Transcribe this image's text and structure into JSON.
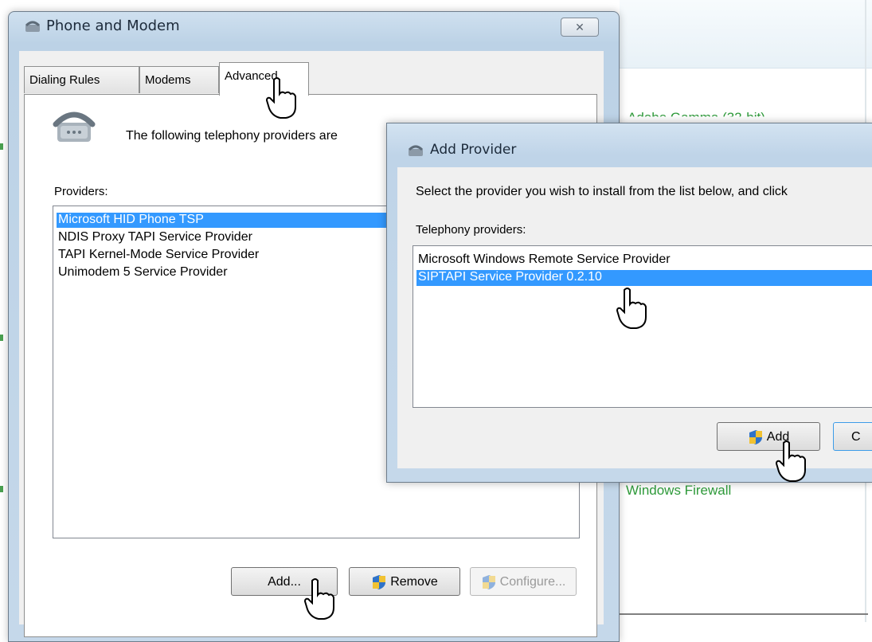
{
  "background": {
    "links": [
      "Adobe Gamma (32-bit)",
      "Windows Firewall"
    ]
  },
  "window": {
    "title": "Phone and Modem",
    "close_label": "✕",
    "tabs": [
      "Dialing Rules",
      "Modems",
      "Advanced"
    ],
    "intro": "The following telephony providers are",
    "providers_label": "Providers:",
    "providers": [
      "Microsoft HID Phone TSP",
      "NDIS Proxy TAPI Service Provider",
      "TAPI Kernel-Mode Service Provider",
      "Unimodem 5 Service Provider"
    ],
    "buttons": {
      "add": "Add...",
      "remove": "Remove",
      "configure": "Configure..."
    }
  },
  "dialog": {
    "title": "Add Provider",
    "instruction": "Select the provider you wish to install from the list below, and click",
    "list_label": "Telephony providers:",
    "items": [
      "Microsoft Windows Remote Service Provider",
      "SIPTAPI Service Provider 0.2.10"
    ],
    "buttons": {
      "add": "Add",
      "cancel": "C"
    }
  }
}
